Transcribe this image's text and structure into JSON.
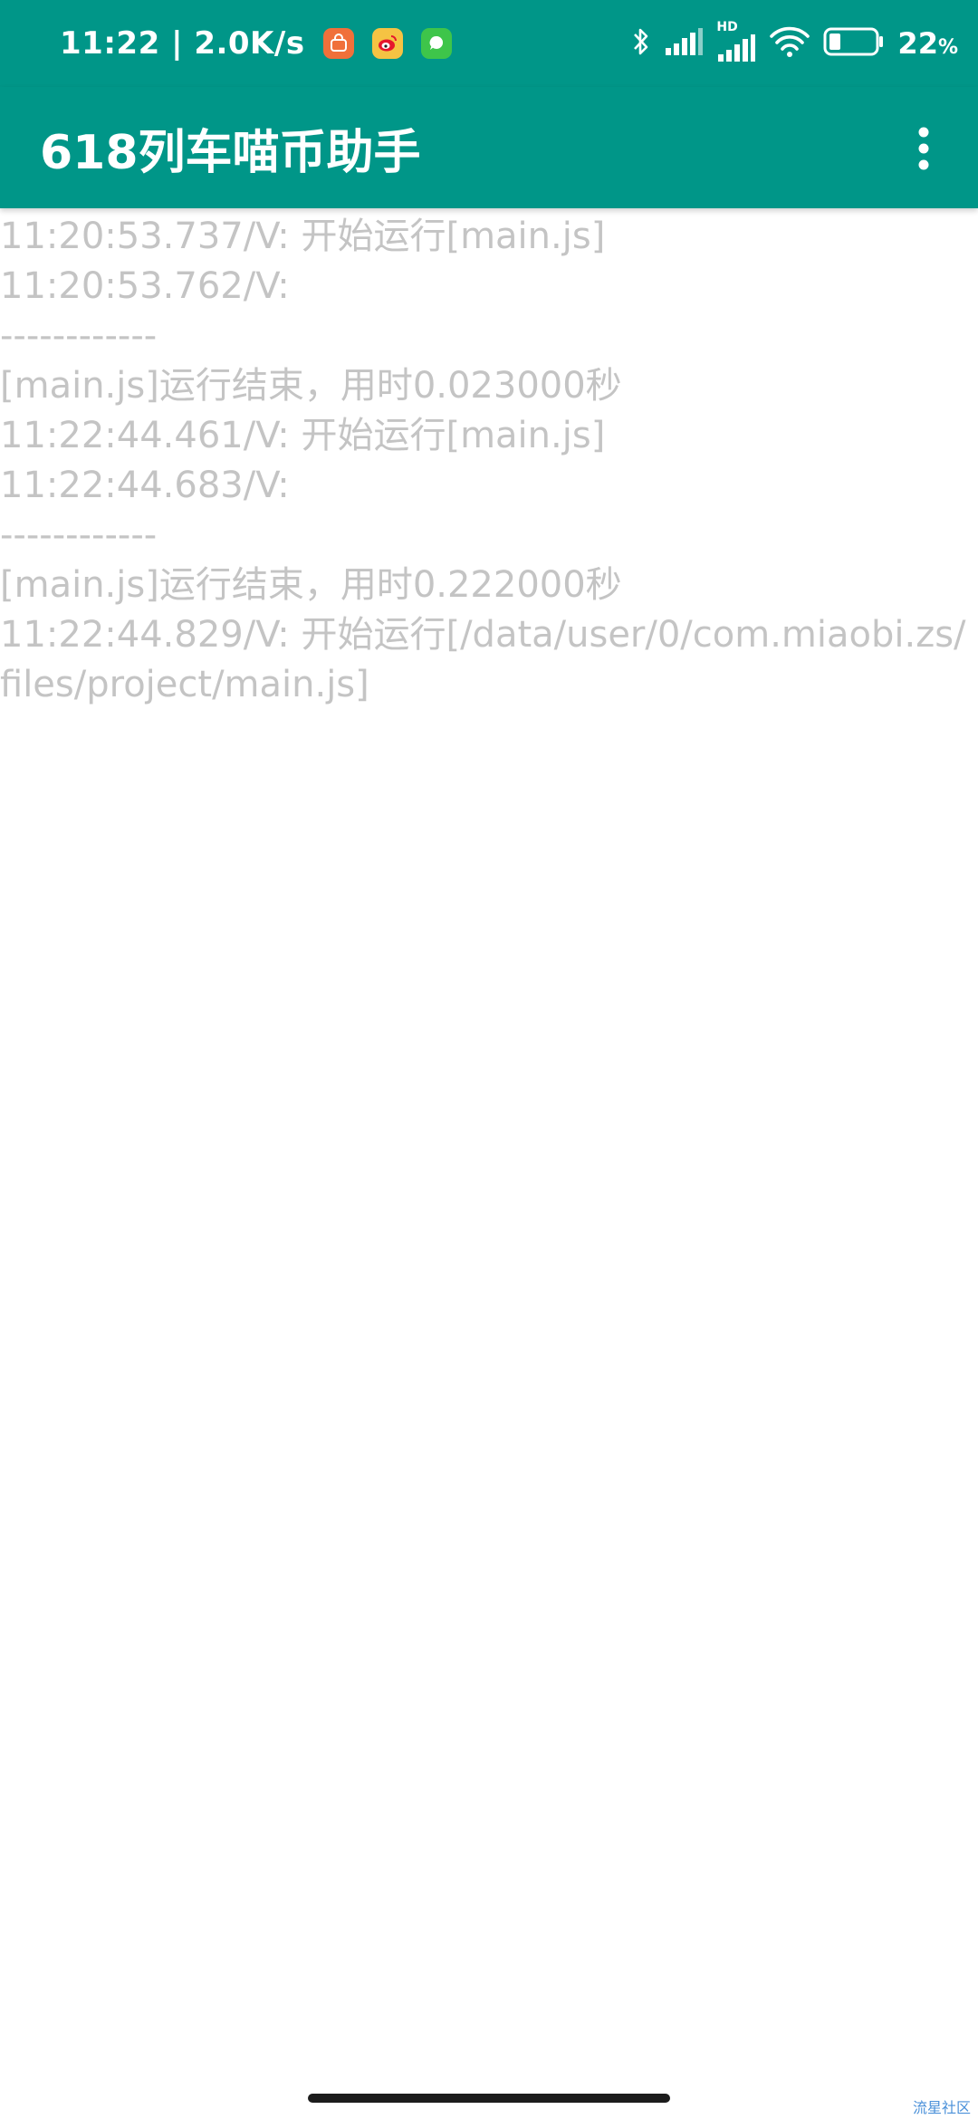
{
  "status_bar": {
    "time_speed": "11:22 | 2.0K/s",
    "battery_percent": "22",
    "battery_unit": "%",
    "icons": [
      "taobao-app-icon",
      "weibo-app-icon",
      "green-app-icon",
      "bluetooth-icon",
      "cell-signal-icon",
      "hd-cell-signal-icon",
      "wifi-icon",
      "battery-icon"
    ],
    "hd_label": "HD"
  },
  "app_bar": {
    "title": "618列车喵币助手",
    "menu_icon": "overflow-menu-icon",
    "color": "#009688"
  },
  "log": {
    "lines": [
      "11:20:53.737/V: 开始运行[main.js]",
      "11:20:53.762/V:",
      "------------",
      "[main.js]运行结束，用时0.023000秒",
      "11:22:44.461/V: 开始运行[main.js]",
      "11:22:44.683/V:",
      "------------",
      "[main.js]运行结束，用时0.222000秒",
      "11:22:44.829/V: 开始运行[/data/user/0/com.miaobi.zs/",
      "files/project/main.js]"
    ],
    "text_color": "#c4c4c4"
  },
  "watermark": "流星社区"
}
